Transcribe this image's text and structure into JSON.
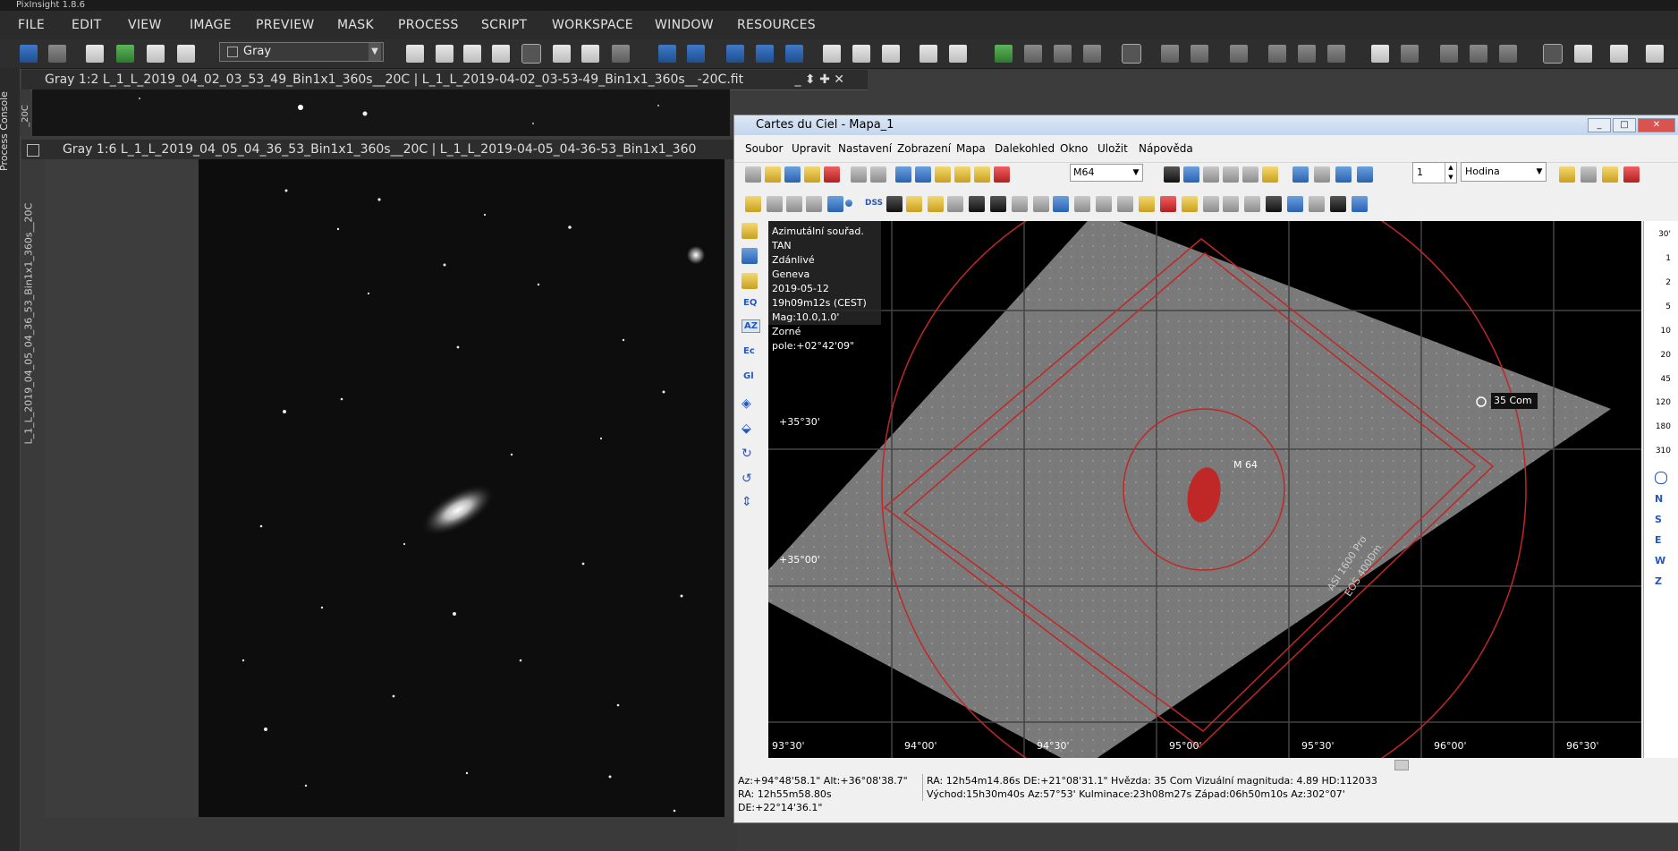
{
  "app": {
    "title": "PixInsight 1.8.6"
  },
  "pi_menu": [
    "FILE",
    "EDIT",
    "VIEW",
    "IMAGE",
    "PREVIEW",
    "MASK",
    "PROCESS",
    "SCRIPT",
    "WORKSPACE",
    "WINDOW",
    "RESOURCES"
  ],
  "pi_toolbar": {
    "colorspace_value": "Gray"
  },
  "console": {
    "label": "Process Console"
  },
  "window1": {
    "title": "Gray 1:2 L_1_L_2019_04_02_03_53_49_Bin1x1_360s__20C | L_1_L_2019-04-02_03-53-49_Bin1x1_360s__-20C.fit",
    "side_label": "_20C"
  },
  "window2": {
    "title": "Gray 1:6 L_1_L_2019_04_05_04_36_53_Bin1x1_360s__20C | L_1_L_2019-04-05_04-36-53_Bin1x1_360",
    "side_label": "L_1_L_2019_04_05_04_36_53_Bin1x1_360s__20C"
  },
  "cdc": {
    "title": "Cartes du Ciel - Mapa_1",
    "menu": [
      "Soubor",
      "Upravit",
      "Nastavení",
      "Zobrazení",
      "Mapa",
      "Dalekohled",
      "Okno",
      "Uložit",
      "Nápověda"
    ],
    "search_value": "M64",
    "step_value": "1",
    "unit_value": "Hodina",
    "dss_label": "DSS",
    "left_toolbar_labels": [
      "EQ",
      "AZ",
      "Ec",
      "Gl"
    ],
    "info": [
      "Azimutální souřad. TAN",
      "Zdánlivé",
      "Geneva",
      "2019-05-12",
      "19h09m12s (CEST)",
      "Mag:10.0,1.0'",
      "Zorné pole:+02°42'09\""
    ],
    "map_labels": {
      "dec1": "+35°30'",
      "dec2": "+35°00'",
      "star": "35 Com",
      "galaxy": "M 64",
      "fov1": "ASI 1600 Pro",
      "fov2": "EOS 400Dm"
    },
    "ra_ticks": [
      "93°30'",
      "94°00'",
      "94°30'",
      "95°00'",
      "95°30'",
      "96°00'",
      "96°30'"
    ],
    "scale": [
      "30'",
      "1",
      "2",
      "5",
      "10",
      "20",
      "45",
      "120",
      "180",
      "310"
    ],
    "directions": [
      "N",
      "S",
      "E",
      "W",
      "Z"
    ],
    "status": {
      "azalt": "Az:+94°48'58.1\" Alt:+36°08'38.7\"",
      "radec": "RA: 12h55m58.80s DE:+22°14'36.1\"",
      "object1": "RA: 12h54m14.86s DE:+21°08'31.1\"  Hvězda: 35 Com  Vizuální magnituda:  4.89  HD:112033",
      "object2": "Východ:15h30m40s Az:57°53'  Kulminace:23h08m27s  Západ:06h50m10s Az:302°07'"
    }
  }
}
